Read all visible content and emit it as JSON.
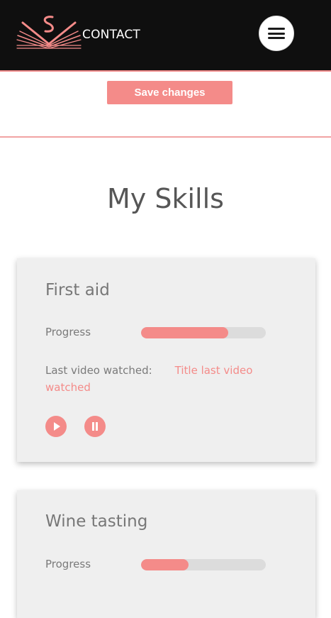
{
  "header": {
    "contact_label": "CONTACT",
    "logo_icon": "logo-icon",
    "menu_icon": "menu-icon",
    "logo_letters": "SV"
  },
  "actions": {
    "save_label": "Save changes"
  },
  "skills_section": {
    "title": "My Skills",
    "skills": [
      {
        "name": "First aid",
        "progress_label": "Progress",
        "progress": 0.7,
        "last_video_label": "Last video watched:",
        "last_video_title": "Title last video watched",
        "play_icon": "play-icon",
        "pause_icon": "pause-icon"
      },
      {
        "name": "Wine tasting",
        "progress_label": "Progress",
        "progress": 0.38
      }
    ]
  },
  "colors": {
    "accent": "#f48b89",
    "header_bg": "#0f0f0f",
    "card_bg": "#efefef",
    "track_bg": "#dcdcdc",
    "text_muted": "#7a7a7a",
    "title_text": "#565656"
  }
}
